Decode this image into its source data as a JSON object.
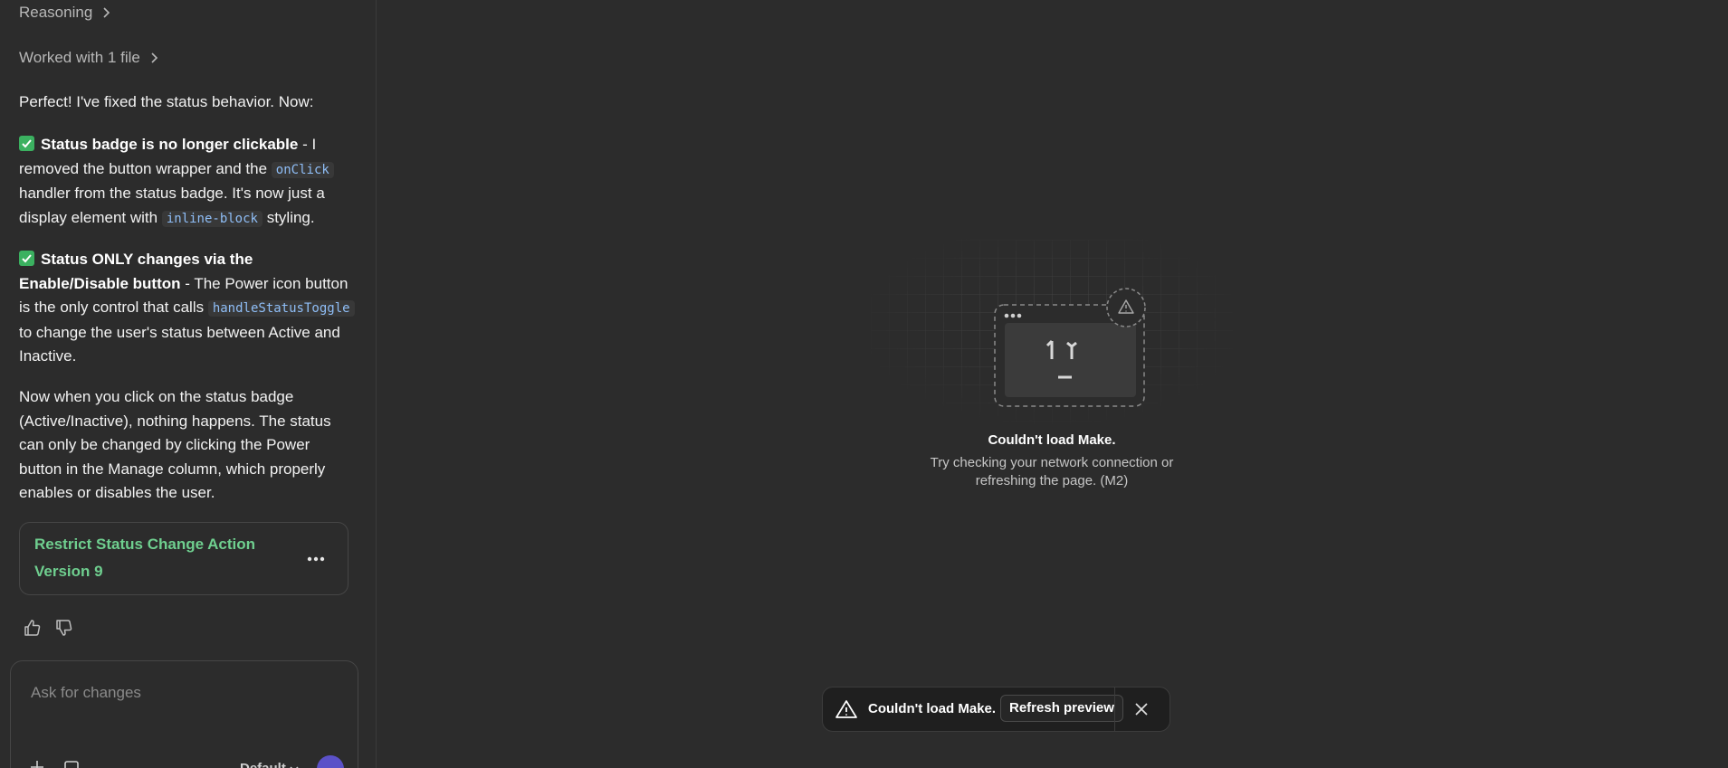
{
  "chat": {
    "reasoning_label": "Reasoning",
    "worked_label": "Worked with 1 file",
    "intro": "Perfect! I've fixed the status behavior. Now:",
    "point1": {
      "bold": "Status badge is no longer clickable",
      "text_a": " - I removed the button wrapper and the ",
      "code_a": "onClick",
      "text_b": " handler from the status badge. It's now just a display element with ",
      "code_b": "inline-block",
      "text_c": " styling."
    },
    "point2": {
      "bold": "Status ONLY changes via the Enable/Disable button",
      "text_a": " - The Power icon button is the only control that calls ",
      "code_a": "handleStatusToggle",
      "text_b": " to change the user's status between Active and Inactive."
    },
    "summary": "Now when you click on the status badge (Active/Inactive), nothing happens. The status can only be changed by clicking the Power button in the Manage column, which properly enables or disables the user.",
    "artifact": {
      "title": "Restrict Status Change Action",
      "version": "Version 9"
    },
    "composer": {
      "placeholder": "Ask for changes",
      "mode": "Default"
    }
  },
  "preview": {
    "error_title": "Couldn't load Make.",
    "error_desc_line1": "Try checking your network connection or",
    "error_desc_line2": "refreshing the page. (M2)",
    "toast": {
      "message": "Couldn't load Make.",
      "refresh_label": "Refresh preview"
    }
  },
  "colors": {
    "background": "#2c2c2c",
    "accent_green": "#6fcf8f",
    "check_green": "#3bb160",
    "code_blue": "#8fbef7",
    "send_purple": "#5b51c8"
  },
  "icons": [
    "chevron-right-icon",
    "check-icon",
    "more-icon",
    "thumbs-up-icon",
    "thumbs-down-icon",
    "plus-icon",
    "attach-icon",
    "chevron-down-icon",
    "warning-icon",
    "close-icon"
  ]
}
